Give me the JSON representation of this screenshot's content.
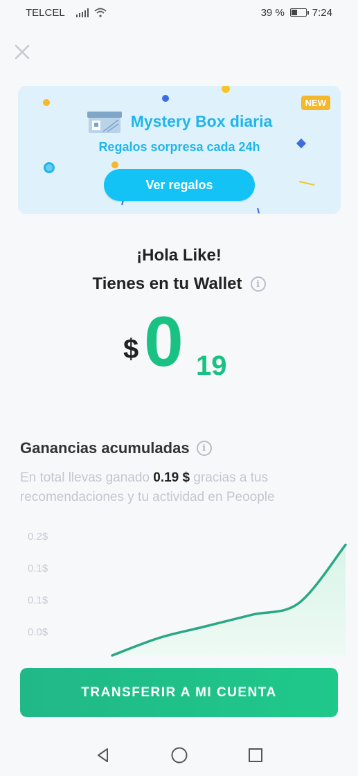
{
  "status": {
    "carrier": "TELCEL",
    "battery": "39 %",
    "time": "7:24"
  },
  "banner": {
    "badge": "NEW",
    "title": "Mystery Box diaria",
    "subtitle": "Regalos sorpresa cada 24h",
    "button": "Ver regalos"
  },
  "wallet": {
    "greeting": "¡Hola Like!",
    "label": "Tienes en tu Wallet",
    "currency": "$",
    "integer": "0",
    "decimals": "19"
  },
  "earnings": {
    "title": "Ganancias acumuladas",
    "desc_before": "En total llevas ganado ",
    "amount": "0.19 $",
    "desc_after": " gracias a tus recomendaciones y tu actividad en Peoople"
  },
  "chart_data": {
    "type": "area",
    "title": "",
    "xlabel": "",
    "ylabel": "",
    "y_tick_labels": [
      "0.2$",
      "0.1$",
      "0.1$",
      "0.0$"
    ],
    "ylim": [
      0,
      0.2
    ],
    "values": [
      0.0,
      0.03,
      0.05,
      0.07,
      0.09,
      0.19
    ],
    "color": "#2aa886",
    "fill": "#d9f4e8",
    "grid": false
  },
  "actions": {
    "transfer": "TRANSFERIR A MI CUENTA"
  },
  "icons": {
    "close": "close-icon",
    "info": "info-icon",
    "back": "back-triangle-icon",
    "home": "home-circle-icon",
    "recents": "recents-square-icon"
  },
  "colors": {
    "accent_green": "#19c283",
    "banner_blue": "#1fb6ea",
    "banner_bg": "#dff1fb",
    "badge": "#f5b72c"
  }
}
